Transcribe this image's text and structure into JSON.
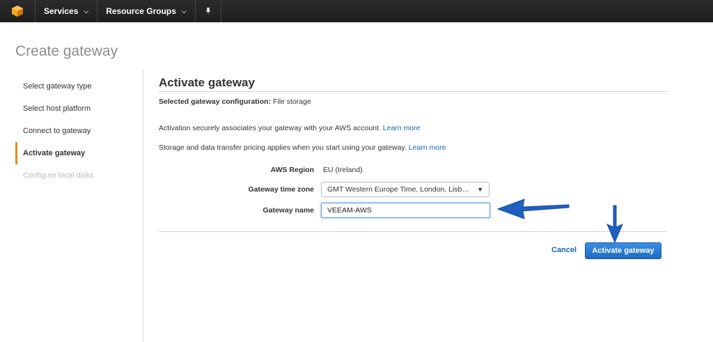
{
  "colors": {
    "topbar": "#232f3e",
    "accent": "#e9891f",
    "link": "#1a64b0",
    "primary_button": "#1e6bc5",
    "annotation_arrow": "#1f5fbf"
  },
  "topbar": {
    "logo_icon": "aws-cube-icon",
    "services_label": "Services",
    "resource_groups_label": "Resource Groups",
    "pin_icon": "pushpin-icon"
  },
  "page": {
    "title": "Create gateway"
  },
  "steps": [
    {
      "label": "Select gateway type",
      "state": "done"
    },
    {
      "label": "Select host platform",
      "state": "done"
    },
    {
      "label": "Connect to gateway",
      "state": "done"
    },
    {
      "label": "Activate gateway",
      "state": "active"
    },
    {
      "label": "Configure local disks",
      "state": "disabled"
    }
  ],
  "main": {
    "title": "Activate gateway",
    "config_label": "Selected gateway configuration:",
    "config_value": "File storage",
    "activation_text": "Activation securely associates your gateway with your AWS account.",
    "activation_link": "Learn more",
    "pricing_text": "Storage and data transfer pricing applies when you start using your gateway.",
    "pricing_link": "Learn more"
  },
  "form": {
    "region_label": "AWS Region",
    "region_value": "EU (Ireland)",
    "timezone_label": "Gateway time zone",
    "timezone_value": "GMT Western Europe Time, London, Lisb…",
    "name_label": "Gateway name",
    "name_value": "VEEAM-AWS"
  },
  "actions": {
    "cancel_label": "Cancel",
    "activate_label": "Activate gateway"
  }
}
